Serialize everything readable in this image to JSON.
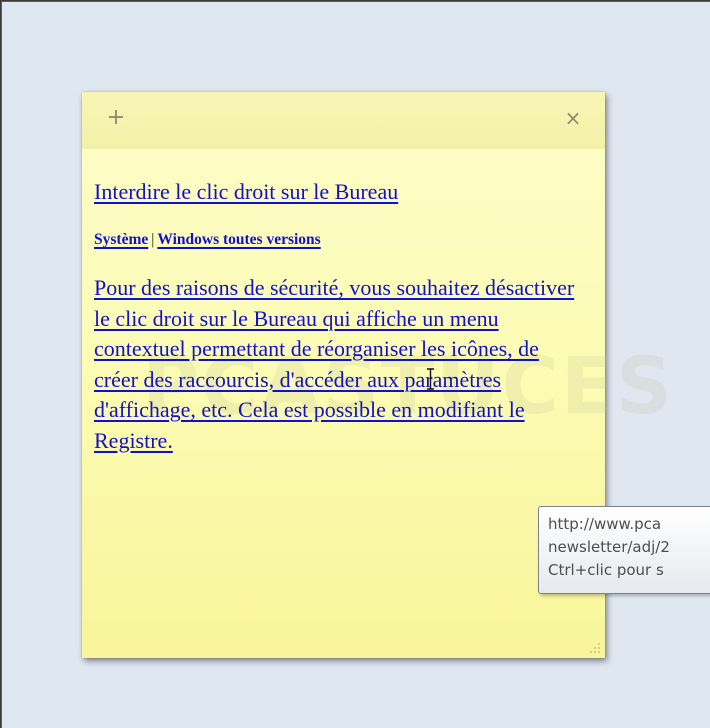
{
  "note": {
    "add_label": "+",
    "close_label": "×",
    "watermark": "PCASTUCES",
    "title": "Interdire le clic droit sur le Bureau",
    "category": "Système",
    "category_separator": "|",
    "subcategory": "Windows toutes versions",
    "description": "Pour des raisons de sécurité, vous souhaitez désactiver le clic droit sur le Bureau qui affiche un menu contextuel permettant de réorganiser les icônes, de créer des raccourcis, d'accéder aux paramètres d'affichage, etc. Cela est possible en modifiant le Registre. "
  },
  "tooltip": {
    "line1": "http://www.pca",
    "line2": "newsletter/adj/2",
    "line3": "Ctrl+clic pour s"
  },
  "colors": {
    "note_bg": "#fcfcb6",
    "link": "#1111cc",
    "desktop_bg": "#dfe7f1"
  },
  "icons": {
    "add": "plus-icon",
    "close": "close-icon",
    "cursor": "text-cursor-icon",
    "resize": "resize-grip-icon"
  }
}
